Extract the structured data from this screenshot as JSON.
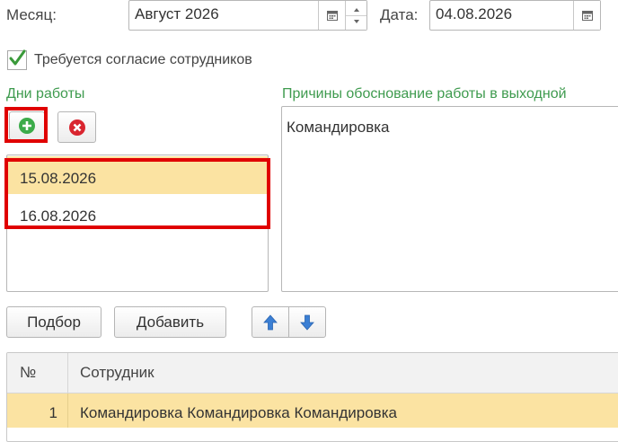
{
  "header": {
    "month_label": "Месяц:",
    "month_value": "Август 2026",
    "date_label": "Дата:",
    "date_value": "04.08.2026",
    "consent_checked": true,
    "consent_label": "Требуется согласие сотрудников"
  },
  "work_days": {
    "section_label": "Дни работы",
    "add_icon": "plus-circle-icon",
    "delete_icon": "x-circle-icon",
    "items": [
      "15.08.2026",
      "16.08.2026"
    ],
    "selected_index": 0
  },
  "reasons": {
    "section_label": "Причины обоснование работы в выходной",
    "text": "Командировка"
  },
  "toolbar": {
    "select_label": "Подбор",
    "add_label": "Добавить",
    "move_up_icon": "arrow-up-icon",
    "move_down_icon": "arrow-down-icon"
  },
  "employees_table": {
    "columns": [
      "№",
      "Сотрудник"
    ],
    "rows": [
      {
        "num": "1",
        "employee": "Командировка Командировка Командировка"
      }
    ]
  },
  "colors": {
    "accent_green": "#3f9b4f",
    "selected_row": "#fbe3a2",
    "highlight_red": "#e00000",
    "arrow_blue": "#3b7fd4"
  }
}
